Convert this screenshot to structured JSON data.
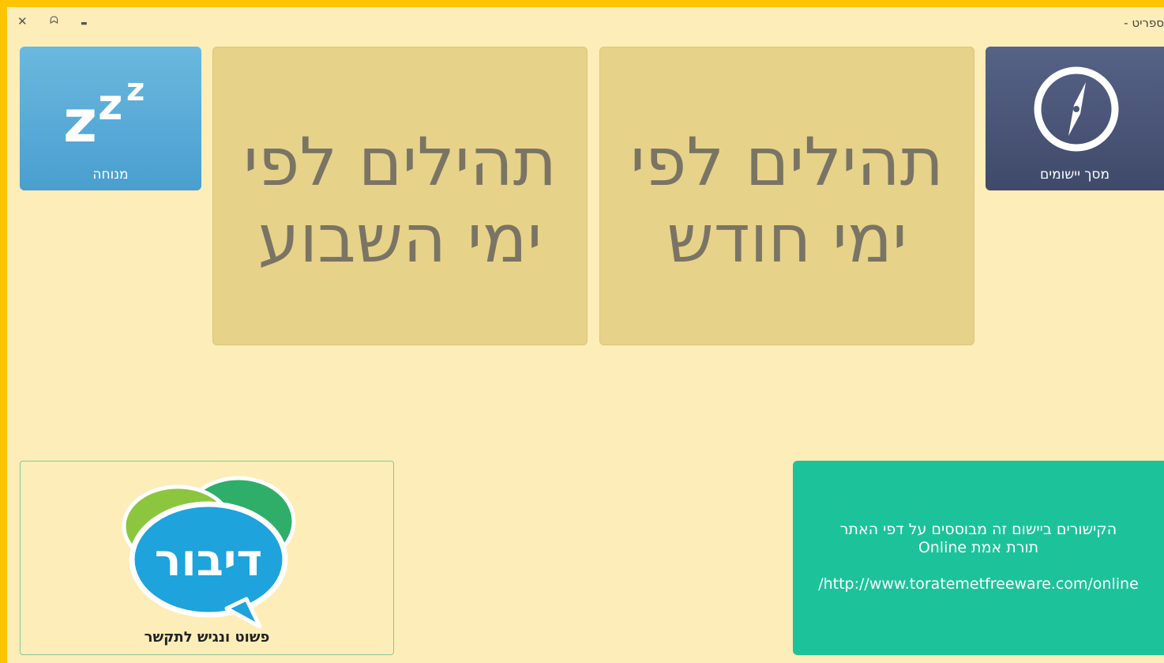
{
  "window": {
    "title": "ספריט -",
    "close_icon": "✕",
    "restore_icon": "ᗣ",
    "minimize_icon": "▬"
  },
  "tiles": {
    "apps_screen": {
      "label": "מסך יישומים",
      "icon": "compass-icon",
      "color": "#4a5577"
    },
    "rest": {
      "label": "מנוחה",
      "icon": "sleep-zzz-icon",
      "color": "#55a9d6"
    },
    "tehilim_month": {
      "line1": "תהילים לפי",
      "line2": "ימי חודש"
    },
    "tehilim_week": {
      "line1": "תהילים לפי",
      "line2": "ימי השבוע"
    },
    "info": {
      "line1": "הקישורים ביישום זה מבוססים על דפי האתר",
      "line2": "תורת אמת Online",
      "url": "/http://www.toratemetfreeware.com/online",
      "color": "#1cc39a"
    },
    "dibur": {
      "logo_text": "דיבור",
      "slogan": "פשוט ונגיש לתקשר"
    }
  },
  "colors": {
    "frame": "#ffc400",
    "background": "#fdedb8",
    "big_tile": "#e7d28a"
  }
}
